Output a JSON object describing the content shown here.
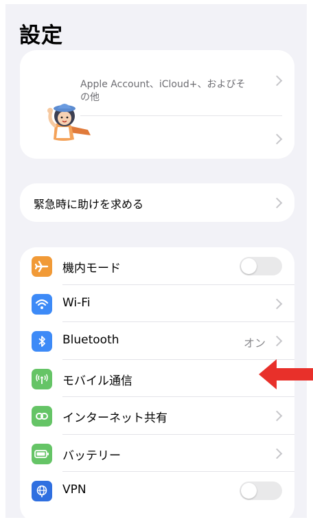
{
  "header": {
    "title": "設定"
  },
  "account": {
    "description": "Apple Account、iCloud+、およびその他"
  },
  "emergency": {
    "label": "緊急時に助けを求める"
  },
  "settings": [
    {
      "label": "機内モード",
      "icon": "airplane-icon",
      "color": "#f19a37",
      "control": "toggle",
      "on": false
    },
    {
      "label": "Wi-Fi",
      "icon": "wifi-icon",
      "color": "#3d8af7",
      "control": "chevron"
    },
    {
      "label": "Bluetooth",
      "icon": "bluetooth-icon",
      "color": "#3d8af7",
      "control": "chevron",
      "value": "オン"
    },
    {
      "label": "モバイル通信",
      "icon": "cellular-icon",
      "color": "#65c466",
      "control": "chevron"
    },
    {
      "label": "インターネット共有",
      "icon": "hotspot-icon",
      "color": "#65c466",
      "control": "chevron"
    },
    {
      "label": "バッテリー",
      "icon": "battery-icon",
      "color": "#65c466",
      "control": "chevron"
    },
    {
      "label": "VPN",
      "icon": "vpn-icon",
      "color": "#2f6fe0",
      "control": "toggle",
      "on": false
    }
  ],
  "annotation": {
    "color": "#e8302a"
  }
}
